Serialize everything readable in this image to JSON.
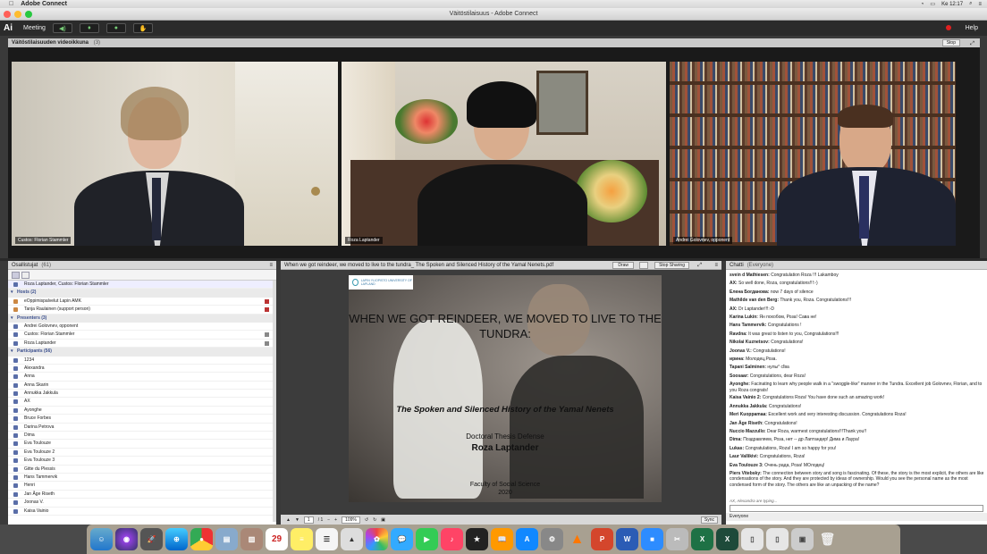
{
  "menubar": {
    "app": "Adobe Connect",
    "clock": "Ke 12:17"
  },
  "window": {
    "title": "Väitöstilaisuus - Adobe Connect"
  },
  "toolbar": {
    "logo": "Ai",
    "meeting": "Meeting",
    "help": "Help"
  },
  "video_pod": {
    "title": "Väitöstilaisuuden videoikkuna",
    "count": "(3)",
    "stop_label": "Stop",
    "feeds": [
      {
        "label": "Custos: Florian Stammler"
      },
      {
        "label": "Roza Laptander"
      },
      {
        "label": "Andrei Golovnev, opponent"
      }
    ]
  },
  "participants": {
    "title": "Osallistujat",
    "count": "(61)",
    "self": "Roza Laptander, Custos: Florian Stammler",
    "groups": [
      {
        "name": "Hosts (2)",
        "members": [
          "eOppimispalvelut Lapin AMK",
          "Tanja Raulainen (support person)"
        ]
      },
      {
        "name": "Presenters (3)",
        "members": [
          "Andrei Golovnev, opponent",
          "Custos: Florian Stammler",
          "Roza Laptander"
        ]
      },
      {
        "name": "Participants (56)",
        "members": [
          "1234",
          "Alexandra",
          "Anna",
          "Anna Skarin",
          "Annukka Jakkula",
          "AX",
          "Ayonghe",
          "Bruce Forbes",
          "Darina Petrova",
          "Dima",
          "Eva Toulouze",
          "Eva Toulouze 2",
          "Eva Toulouze 3",
          "Gitte du Plessis",
          "Hans Tammervik",
          "Henri",
          "Jan Åge Riseth",
          "Joonas V.",
          "Kaisa Vainio"
        ]
      }
    ]
  },
  "share_pod": {
    "title": "When we got reindeer, we moved to live to the tundra_ The Spoken and Silenced History of the Yamal Nenets.pdf",
    "draw_label": "Draw",
    "stop_label": "Stop Sharing",
    "page": "1",
    "pages": "/ 1",
    "zoom": "109%",
    "sync_label": "Sync",
    "slide": {
      "logo": "LAPIN YLIOPISTO UNIVERSITY OF LAPLAND",
      "title": "WHEN WE GOT REINDEER, WE MOVED TO LIVE TO THE TUNDRA:",
      "subtitle": "The Spoken and Silenced History of the Yamal Nenets",
      "kind": "Doctoral Thesis Defense",
      "author": "Roza Laptander",
      "faculty": "Faculty of Social Science",
      "year": "2020"
    }
  },
  "chat": {
    "title": "Chatti",
    "scope": "(Everyone)",
    "messages": [
      {
        "from": "svein d Mathiesen:",
        "text": "Congratulation Roza !!! Lakamboy"
      },
      {
        "from": "AX:",
        "text": "So well done, Roza, congratulations!!!:-)"
      },
      {
        "from": "Елена Богданова:",
        "text": "now 7 days of silence"
      },
      {
        "from": "Mathilde van den Berg:",
        "text": "Thank you, Roza. Congratulations!!!"
      },
      {
        "from": "AX:",
        "text": "Dr Laptander!!!:-D"
      },
      {
        "from": "Karina Lukin:",
        "text": "Ян похобом, Роза! Сава не!"
      },
      {
        "from": "Hans Tammervik:",
        "text": "Congratulations !"
      },
      {
        "from": "Ravdna:",
        "text": "It was great to listen to you, Congratulations!!!"
      },
      {
        "from": "Nikolai Kuznetsov:",
        "text": "Congratulations!"
      },
      {
        "from": "Joonas V.:",
        "text": "Congratulations!"
      },
      {
        "from": "ирина:",
        "text": "Молодец,Роза."
      },
      {
        "from": "Tapani Salminen:",
        "text": "нулы° сĭва"
      },
      {
        "from": "Soosaar:",
        "text": "Congratulations, dear Roza!"
      },
      {
        "from": "Ayonghe:",
        "text": "Facinating  to learn why people walk in a \"swoggle-like\" manner in the Tundra. Excellent job Golovnev, Florian, and to you Roza congrats!"
      },
      {
        "from": "Kaisa Vainio 2:",
        "text": "Congratulations Roza! You have done such an amazing work!"
      },
      {
        "from": "Annukka Jakkula:",
        "text": "Congratulations!"
      },
      {
        "from": "Meri Kuoppamaa:",
        "text": "Excellent work and very interesting discussion. Congratulations Roza!"
      },
      {
        "from": "Jan Åge Riseth:",
        "text": "Congratulations!"
      },
      {
        "from": "Nuccio Mazzullo:",
        "text": "Dear Roza, warmest congratulations!!!Thank you!!"
      },
      {
        "from": "Dima:",
        "text": "Поздравляем, Роза, нет -- др Лаптандер! Дима и Лаура!"
      },
      {
        "from": "Lukas:",
        "text": "Congratulations, Roza! I am so happy for you!"
      },
      {
        "from": "Laur Vallikivi:",
        "text": "Congratulations, Roza!"
      },
      {
        "from": "Eva Toulouze 3:",
        "text": "Очень рада, Роза! МОлодец!"
      },
      {
        "from": "Piers Vitebsky:",
        "text": "The connection between story and song is fascinating.  Of these, the story is the most explicit, the others are like condensations of the story.  And they are protected by ideas of ownership.  Would you see the personal name as the most condensed form of the story.  The others are like an unpacking of the name?"
      }
    ],
    "typing": "AX, Alexandra are typing...",
    "recipient": "Everyone"
  },
  "dock": {
    "calendar_day": "29"
  },
  "colors": {
    "accent": "#3a4e8c",
    "record": "#e02020"
  }
}
